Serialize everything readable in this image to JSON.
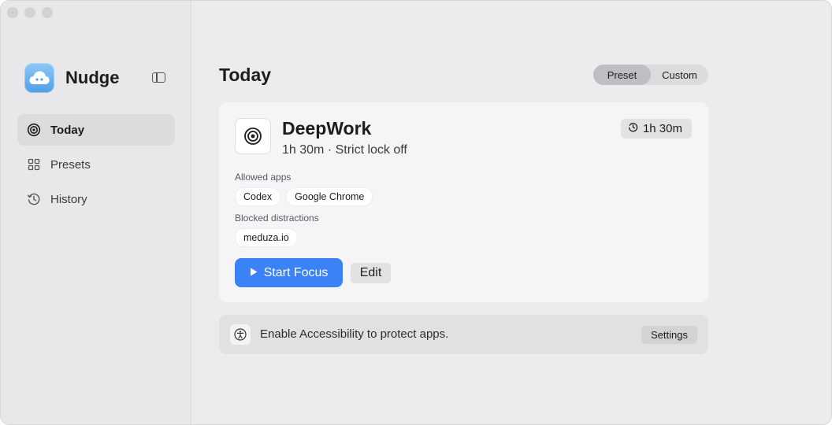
{
  "app": {
    "name": "Nudge"
  },
  "sidebar": {
    "items": [
      {
        "label": "Today",
        "icon": "target-icon",
        "active": true
      },
      {
        "label": "Presets",
        "icon": "grid-icon",
        "active": false
      },
      {
        "label": "History",
        "icon": "history-clock-icon",
        "active": false
      }
    ]
  },
  "main": {
    "title": "Today",
    "segments": [
      {
        "label": "Preset",
        "selected": true
      },
      {
        "label": "Custom",
        "selected": false
      }
    ],
    "preset": {
      "name": "DeepWork",
      "subtitle": "1h 30m · Strict lock off",
      "duration": "1h 30m",
      "allowed_label": "Allowed apps",
      "allowed_apps": [
        "Codex",
        "Google Chrome"
      ],
      "blocked_label": "Blocked distractions",
      "blocked_sites": [
        "meduza.io"
      ],
      "start_label": "Start Focus",
      "edit_label": "Edit"
    },
    "banner": {
      "text": "Enable Accessibility to protect apps.",
      "button_label": "Settings"
    }
  },
  "colors": {
    "accent": "#3b82f6",
    "sidebar_bg": "#e8e8eb",
    "content_bg": "#ececee",
    "card_bg": "#f5f5f7"
  }
}
